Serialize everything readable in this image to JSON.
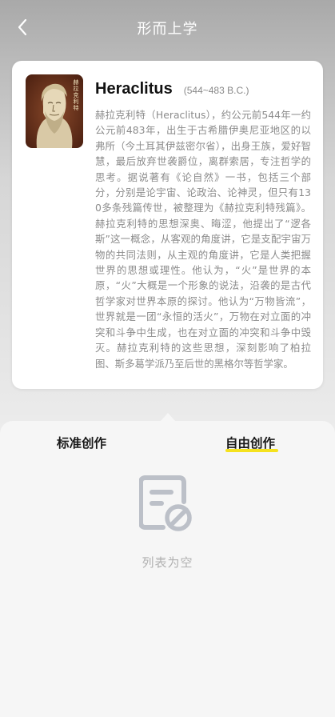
{
  "header": {
    "title": "形而上学"
  },
  "philosopher": {
    "portrait_caption": "赫拉克利特",
    "name": "Heraclitus",
    "years": "(544~483 B.C.)",
    "bio": "赫拉克利特（Heraclitus），约公元前544年一约公元前483年，出生于古希腊伊奥尼亚地区的以弗所（今土耳其伊兹密尔省），出身王族，爱好智慧，最后放弃世袭爵位，离群索居，专注哲学的思考。据说著有《论自然》一书，包括三个部分，分别是论宇宙、论政治、论神灵，但只有130多条残篇传世，被整理为《赫拉克利特残篇》。赫拉克利特的思想深奥、晦涩，他提出了“逻各斯”这一概念，从客观的角度讲，它是支配宇宙万物的共同法则，从主观的角度讲，它是人类把握世界的思想或理性。他认为，“火”是世界的本原，“火”大概是一个形象的说法，沿袭的是古代哲学家对世界本原的探讨。他认为“万物皆流”，世界就是一团“永恒的活火”，万物在对立面的冲突和斗争中生成，也在对立面的冲突和斗争中毁灭。赫拉克利特的这些思想，深刻影响了柏拉图、斯多葛学派乃至后世的黑格尔等哲学家。"
  },
  "tabs": [
    {
      "label": "标准创作",
      "active": false
    },
    {
      "label": "自由创作",
      "active": true
    }
  ],
  "empty_state": {
    "icon": "empty-document-icon",
    "text": "列表为空"
  },
  "colors": {
    "accent_underline": "#f5e21e",
    "sheet_background": "#f6f6f6"
  }
}
